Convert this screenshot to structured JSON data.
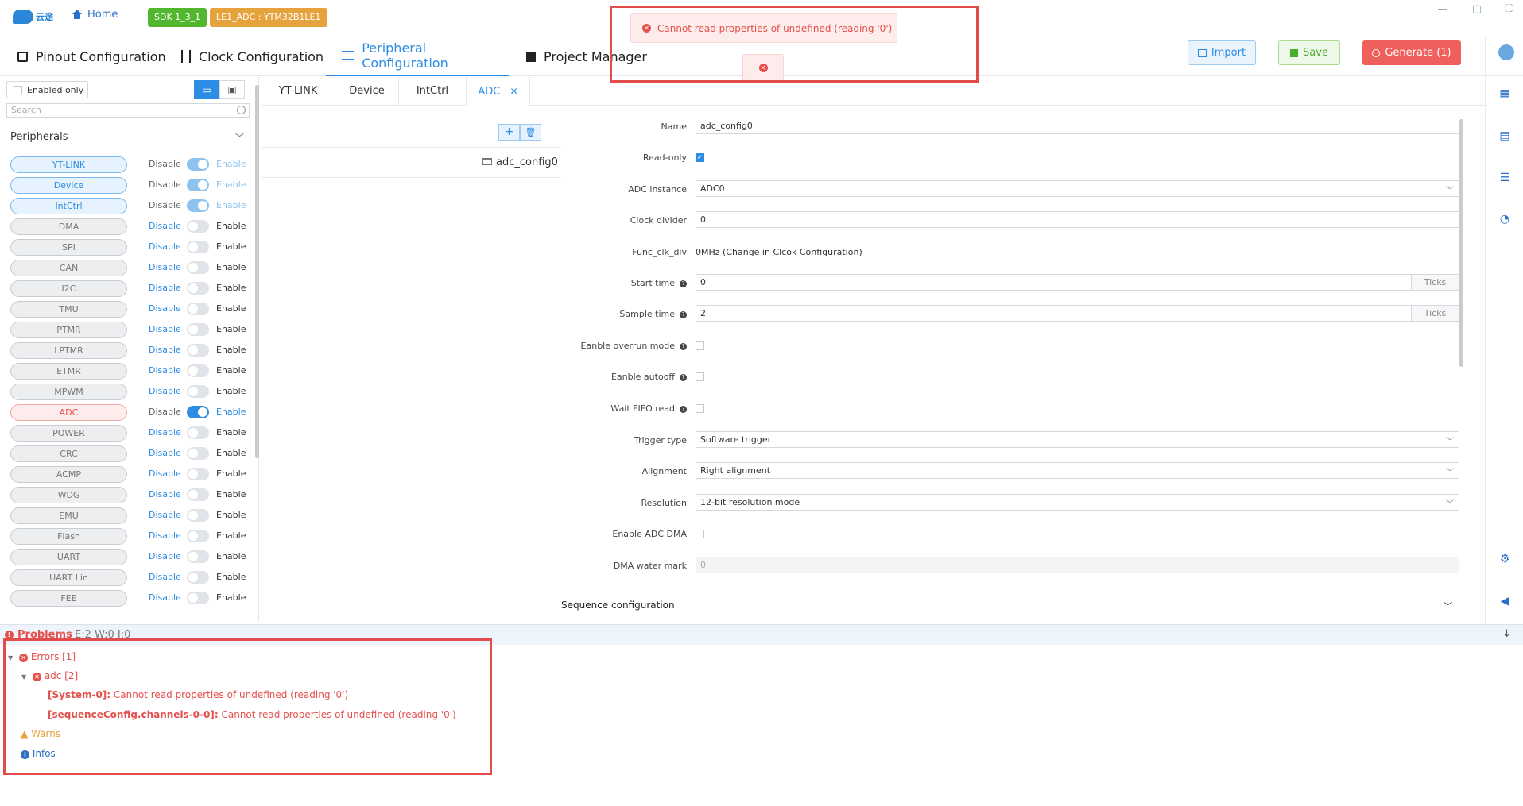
{
  "app": {
    "logo_text": "云途",
    "home": "Home",
    "sdk_badge": "SDK 1_3_1",
    "project_badge": "LE1_ADC : YTM32B1LE1"
  },
  "toast": {
    "message": "Cannot read properties of undefined (reading '0')"
  },
  "window_controls": [
    "—",
    "▢",
    "⛶",
    "✕"
  ],
  "main_tabs": [
    "Pinout Configuration",
    "Clock Configuration",
    "Peripheral Configuration",
    "Project Manager"
  ],
  "toolbar": {
    "import": "Import",
    "save": "Save",
    "generate": "Generate (1)"
  },
  "left": {
    "enabled_only": "Enabled only",
    "search_placeholder": "Search",
    "peripherals_title": "Peripherals",
    "disable_label": "Disable",
    "enable_label": "Enable",
    "items": [
      {
        "name": "YT-LINK",
        "enabled": true,
        "locked": true
      },
      {
        "name": "Device",
        "enabled": true,
        "locked": true
      },
      {
        "name": "IntCtrl",
        "enabled": true,
        "locked": true
      },
      {
        "name": "DMA",
        "enabled": false
      },
      {
        "name": "SPI",
        "enabled": false
      },
      {
        "name": "CAN",
        "enabled": false
      },
      {
        "name": "I2C",
        "enabled": false
      },
      {
        "name": "TMU",
        "enabled": false
      },
      {
        "name": "PTMR",
        "enabled": false
      },
      {
        "name": "LPTMR",
        "enabled": false
      },
      {
        "name": "ETMR",
        "enabled": false
      },
      {
        "name": "MPWM",
        "enabled": false
      },
      {
        "name": "ADC",
        "enabled": true,
        "error": true
      },
      {
        "name": "POWER",
        "enabled": false
      },
      {
        "name": "CRC",
        "enabled": false
      },
      {
        "name": "ACMP",
        "enabled": false
      },
      {
        "name": "WDG",
        "enabled": false
      },
      {
        "name": "EMU",
        "enabled": false
      },
      {
        "name": "Flash",
        "enabled": false
      },
      {
        "name": "UART",
        "enabled": false
      },
      {
        "name": "UART Lin",
        "enabled": false
      },
      {
        "name": "FEE",
        "enabled": false
      }
    ]
  },
  "sub_tabs": [
    "YT-LINK",
    "Device",
    "IntCtrl",
    "ADC"
  ],
  "config_list": {
    "item": "adc_config0"
  },
  "form": {
    "name_label": "Name",
    "name_value": "adc_config0",
    "readonly_label": "Read-only",
    "instance_label": "ADC instance",
    "instance_value": "ADC0",
    "clkdiv_label": "Clock divider",
    "clkdiv_value": "0",
    "funcclk_label": "Func_clk_div",
    "funcclk_value": "0MHz (Change in Clcok Configuration)",
    "start_label": "Start time",
    "start_value": "0",
    "start_unit": "Ticks",
    "sample_label": "Sample time",
    "sample_value": "2",
    "sample_unit": "Ticks",
    "overrun_label": "Eanble overrun mode",
    "autooff_label": "Eanble autooff",
    "fifo_label": "Wait FIFO read",
    "trigger_label": "Trigger type",
    "trigger_value": "Software trigger",
    "align_label": "Alignment",
    "align_value": "Right alignment",
    "res_label": "Resolution",
    "res_value": "12-bit resolution mode",
    "dma_label": "Enable ADC DMA",
    "water_label": "DMA water mark",
    "water_value": "0",
    "sequence_label": "Sequence configuration"
  },
  "problems": {
    "title": "Problems",
    "counts": "E:2 W:0 I:0",
    "errors_label": "Errors [1]",
    "adc_label": "adc [2]",
    "err1_key": "[System-0]:",
    "err1_msg": "Cannot read properties of undefined (reading '0')",
    "err2_key": "[sequenceConfig.channels-0-0]:",
    "err2_msg": "Cannot read properties of undefined (reading '0')",
    "warns_label": "Warns",
    "infos_label": "Infos"
  },
  "colors": {
    "accent": "#2d8ce3",
    "error": "#e5504c",
    "success": "#4cae2f",
    "warning": "#e6a23c"
  }
}
